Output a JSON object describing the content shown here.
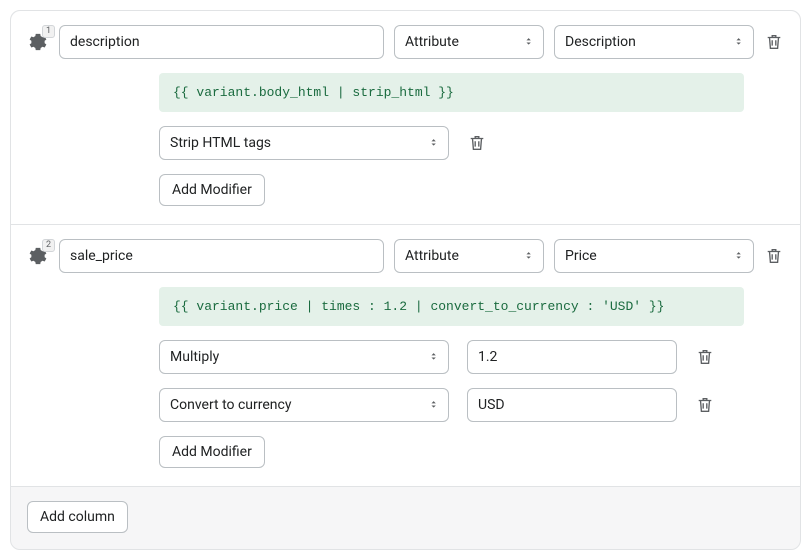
{
  "columns": [
    {
      "index": "1",
      "name": "description",
      "type_label": "Attribute",
      "attribute_label": "Description",
      "code": "{{ variant.body_html | strip_html }}",
      "modifiers": [
        {
          "label": "Strip HTML tags",
          "arg": null
        }
      ]
    },
    {
      "index": "2",
      "name": "sale_price",
      "type_label": "Attribute",
      "attribute_label": "Price",
      "code": "{{ variant.price | times : 1.2 | convert_to_currency : 'USD' }}",
      "modifiers": [
        {
          "label": "Multiply",
          "arg": "1.2"
        },
        {
          "label": "Convert to currency",
          "arg": "USD"
        }
      ]
    }
  ],
  "buttons": {
    "add_modifier": "Add Modifier",
    "add_column": "Add column"
  }
}
